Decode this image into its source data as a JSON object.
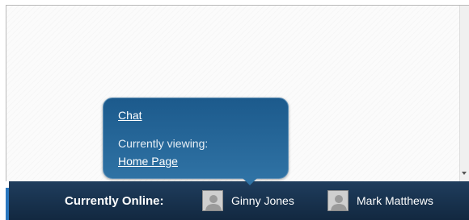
{
  "tooltip": {
    "chat_link": "Chat",
    "viewing_label": "Currently viewing:",
    "page_link": "Home Page"
  },
  "bottom_bar": {
    "label": "Currently Online:",
    "users": [
      {
        "name": "Ginny Jones",
        "avatar_icon": "user-silhouette-icon"
      },
      {
        "name": "Mark Matthews",
        "avatar_icon": "user-silhouette-icon"
      }
    ]
  },
  "colors": {
    "bar_background": "#1a3350",
    "tooltip_background": "#2a6898",
    "accent": "#2a78c0"
  }
}
